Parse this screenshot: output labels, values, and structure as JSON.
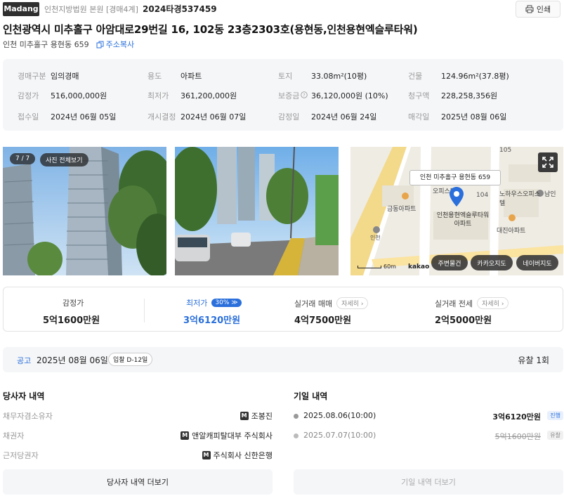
{
  "header": {
    "logo": "Madang",
    "court": "인천지방법원 본원 [경매4계]",
    "case_number": "2024타경537459",
    "print_label": "인쇄"
  },
  "property": {
    "title": "인천광역시 미추홀구 아암대로29번길 16, 102동 23층2303호(용현동,인천용현엑슬루타워)",
    "lot_address": "인천 미추홀구 용현동 659",
    "copy_label": "주소복사"
  },
  "info": {
    "auction_type_label": "경매구분",
    "auction_type": "임의경매",
    "usage_label": "용도",
    "usage": "아파트",
    "land_label": "토지",
    "land": "33.08m²(10평)",
    "building_label": "건물",
    "building": "124.96m²(37.8평)",
    "appraisal_label": "감정가",
    "appraisal": "516,000,000원",
    "min_price_label": "최저가",
    "min_price": "361,200,000원",
    "deposit_label": "보증금",
    "deposit": "36,120,000원 (10%)",
    "claim_label": "청구액",
    "claim": "228,258,356원",
    "received_label": "접수일",
    "received": "2024년 06월 05일",
    "start_label": "개시결정",
    "start": "2024년 06월 07일",
    "appraise_date_label": "감정일",
    "appraise_date": "2024년 06월 24일",
    "sale_date_label": "매각일",
    "sale_date": "2025년 08월 06일"
  },
  "photos": {
    "counter": "7 / 7",
    "view_all": "사진 전체보기"
  },
  "map": {
    "popup": "인천 미추홀구 용현동 659",
    "building_name": "인천용현엑슬루타워아파트",
    "labels": [
      "금동아파트",
      "오피스텔",
      "노하우스오피스텔",
      "남인",
      "대진아파트",
      "인천",
      "104",
      "105"
    ],
    "scale": "60m",
    "brand": "kakao",
    "buttons": [
      "주변물건",
      "카카오지도",
      "네이버지도"
    ]
  },
  "prices": {
    "appraisal_label": "감정가",
    "appraisal": "5억1600만원",
    "min_label": "최저가",
    "min_pct": "30%",
    "min": "3억6120만원",
    "trade_label": "실거래 매매",
    "trade": "4억7500만원",
    "rent_label": "실거래 전세",
    "rent": "2억5000만원",
    "detail_label": "자세히"
  },
  "notice": {
    "label": "공고",
    "date": "2025년 08월 06일",
    "dday": "입찰 D-12일",
    "fail_count": "유찰 1회"
  },
  "parties": {
    "title": "당사자 내역",
    "rows": [
      {
        "role": "채무자겸소유자",
        "name": "조봉진"
      },
      {
        "role": "채권자",
        "name": "앤알캐피탈대부 주식회사"
      },
      {
        "role": "근저당권자",
        "name": "주식회사 신한은행"
      }
    ],
    "more": "당사자 내역 더보기"
  },
  "dates": {
    "title": "기일 내역",
    "rows": [
      {
        "date": "2025.08.06(10:00)",
        "amount": "3억6120만원",
        "status": "진행"
      },
      {
        "date": "2025.07.07(10:00)",
        "amount": "5억1600만원",
        "status": "유찰"
      }
    ],
    "more": "기일 내역 더보기"
  },
  "colors": {
    "accent": "#2a6fdb",
    "logo_bg": "#2f2f2f",
    "panel_bg": "#f5f6f8"
  }
}
